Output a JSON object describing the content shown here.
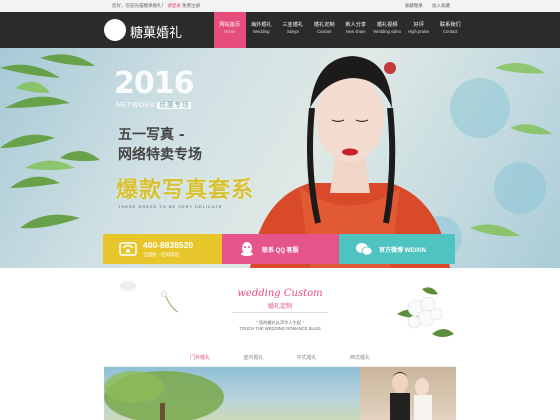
{
  "topbar": {
    "welcome": "您好，欢迎光临糖果婚礼！",
    "login": "请登录",
    "register": "免费注册",
    "favorite": "收藏糖果",
    "add": "加入收藏"
  },
  "brand": {
    "name": "糖菓婚礼"
  },
  "nav": [
    {
      "zh": "网站首页",
      "en": "Home"
    },
    {
      "zh": "海外婚礼",
      "en": "Wedding"
    },
    {
      "zh": "三亚婚礼",
      "en": "Sanya"
    },
    {
      "zh": "婚礼定制",
      "en": "Custom"
    },
    {
      "zh": "新人分享",
      "en": "New share"
    },
    {
      "zh": "婚礼视频",
      "en": "Wedding video"
    },
    {
      "zh": "好评",
      "en": "High praise"
    },
    {
      "zh": "联系我们",
      "en": "Contact"
    }
  ],
  "hero": {
    "year": "2016",
    "network": "NETWORK",
    "network_tag": "优惠专场",
    "line1": "五一写真 -",
    "line2": "网络特卖专场",
    "line3": "爆款写真套系",
    "small": "THESE DRESS TO BE VERY DELICATE"
  },
  "contact": {
    "phone": "400-8838520",
    "phone_sub": "全国统一咨询电话",
    "qq": "联系 QQ 客服",
    "weibo": "官方微博 WEIXIN"
  },
  "section": {
    "title_en": "wedding Custom",
    "title_zh": "婚礼定制",
    "sub1": "\" 您的婚礼从浮华人生起 \"",
    "sub2": "TOUCH THE WEDDING ROMANCE BLISS"
  },
  "tabs": [
    "门外婚礼",
    "室内婚礼",
    "中式婚礼",
    "西式婚礼"
  ],
  "colors": {
    "accent": "#e64d7a",
    "yellow": "#e6c62a",
    "pink": "#e6558a",
    "teal": "#4ec3c0",
    "header": "#1c1c1c"
  }
}
